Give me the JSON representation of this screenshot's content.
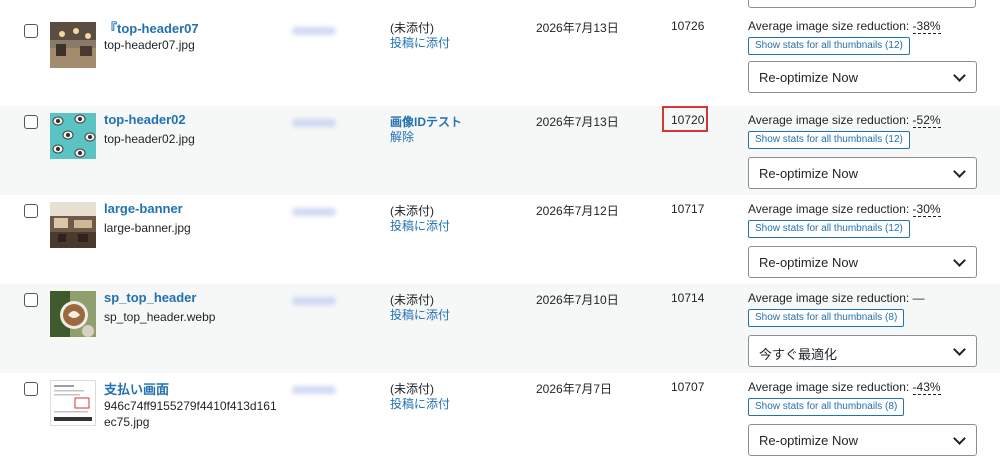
{
  "rows": [
    {
      "title": "『top-header07",
      "filename": "top-header07.jpg",
      "attach_status": "(未添付)",
      "attach_action": "投稿に添付",
      "date": "2026年7月13日",
      "id": "10726",
      "reduction_label": "Average image size reduction:",
      "reduction_value": "-38%",
      "stats_button": "Show stats for all thumbnails (12)",
      "action_select": "Re-optimize Now",
      "thumb_icon": "cafe-interior-thumbnail"
    },
    {
      "title": "top-header02",
      "filename": "top-header02.jpg",
      "attach_status": "画像IDテスト",
      "attach_action": "解除",
      "date": "2026年7月13日",
      "id": "10720",
      "reduction_label": "Average image size reduction:",
      "reduction_value": "-52%",
      "stats_button": "Show stats for all thumbnails (12)",
      "action_select": "Re-optimize Now",
      "thumb_icon": "coffee-cups-pattern-thumbnail"
    },
    {
      "title": "large-banner",
      "filename": "large-banner.jpg",
      "attach_status": "(未添付)",
      "attach_action": "投稿に添付",
      "date": "2026年7月12日",
      "id": "10717",
      "reduction_label": "Average image size reduction:",
      "reduction_value": "-30%",
      "stats_button": "Show stats for all thumbnails (12)",
      "action_select": "Re-optimize Now",
      "thumb_icon": "restaurant-interior-thumbnail"
    },
    {
      "title": "sp_top_header",
      "filename": "sp_top_header.webp",
      "attach_status": "(未添付)",
      "attach_action": "投稿に添付",
      "date": "2026年7月10日",
      "id": "10714",
      "reduction_label": "Average image size reduction:",
      "reduction_value": "—",
      "stats_button": "Show stats for all thumbnails (8)",
      "action_select": "今すぐ最適化",
      "thumb_icon": "latte-art-thumbnail"
    },
    {
      "title": "支払い画面",
      "filename": "946c74ff9155279f4410f413d161ec75.jpg",
      "attach_status": "(未添付)",
      "attach_action": "投稿に添付",
      "date": "2026年7月7日",
      "id": "10707",
      "reduction_label": "Average image size reduction:",
      "reduction_value": "-43%",
      "stats_button": "Show stats for all thumbnails (8)",
      "action_select": "Re-optimize Now",
      "thumb_icon": "payment-screen-thumbnail"
    }
  ],
  "colors": {
    "link": "#2271b1",
    "highlight": "#d63638",
    "alt_row": "#f6f7f7"
  }
}
